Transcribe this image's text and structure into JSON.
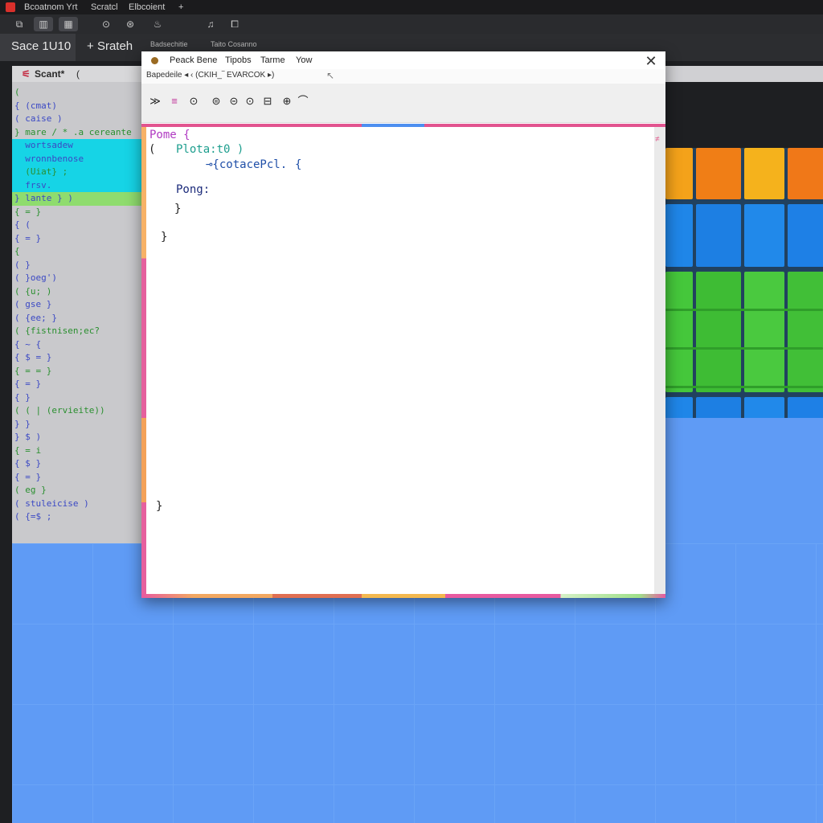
{
  "titlebar": {
    "title": "Bcoatnom Yrt",
    "item2": "Scratcl",
    "item3": "Elbcoient",
    "plus": "+"
  },
  "iconstrip": {
    "icons": [
      "⧉",
      "▥",
      "▦",
      "⊙",
      "⊛",
      "♨",
      "♫",
      "⧠"
    ]
  },
  "tabs": {
    "main": "Sace 1U10",
    "second": "Srateh",
    "small1": "Badsechitie",
    "small2": "Taito Cosanno"
  },
  "editor": {
    "header": "Scant*",
    "header_brace": "(",
    "lines": [
      "(",
      "{ (cmat)",
      "( caise )",
      "} mare / * .a cereante",
      "  wortsadew",
      "  wronnbenose",
      "  (Uiat} ;",
      "  frsv.",
      "} lante } )",
      "{ = }",
      "{ (",
      "{ = }",
      "{",
      "( }",
      "( }oeg')",
      "( {u; )",
      "( gse }",
      "( {ee; }",
      "( {fistnisen;ec?",
      "{ ~ {",
      "{ $ = }",
      "{ = = }",
      "{ = }",
      "{ }",
      "( ( | (ervieite))",
      "} }",
      "} $ )",
      "{ = i",
      "{ $ }",
      "{ = }",
      "( eg }",
      "( stuleicise )",
      "( {=$ ;"
    ]
  },
  "dialog": {
    "menu": [
      "Peack Bene",
      "Tipobs",
      "Tarme",
      "Yow"
    ],
    "close_icon": "✕",
    "path": "Bapedeile ◂ ‹ (CKIH_‾ EVARCOK ▸)",
    "toolbar": [
      "≫",
      "≡",
      "⊙",
      "⊜",
      "⊝",
      "⊙",
      "⊟",
      "⊕",
      "⌒"
    ],
    "code": {
      "line1": "Pome {",
      "line2_brace": "(",
      "line2": "Plota:t0 )",
      "line3": "⊸{cotacePcl.",
      "line3_brace": "{",
      "line4": "Pong:",
      "line5": "}",
      "line6": "}",
      "line7": "}"
    }
  },
  "colors": {
    "stage": "#5f9bf5",
    "dialog_bg": "#ffffff",
    "editor_bg": "#c9c9cc"
  }
}
